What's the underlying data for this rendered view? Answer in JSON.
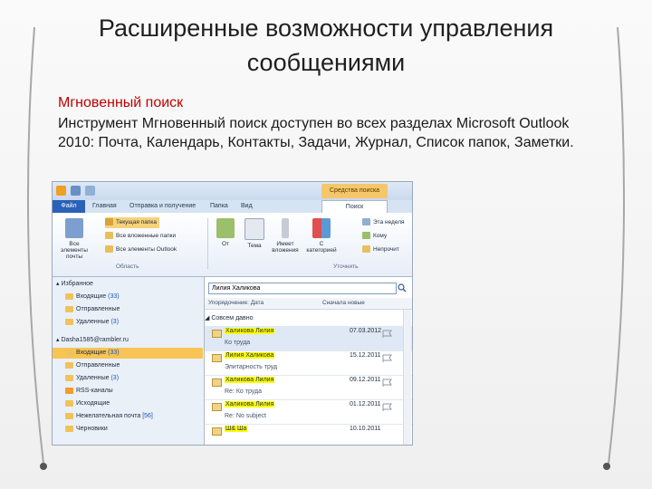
{
  "slide": {
    "title_line1": "Расширенные возможности управления",
    "title_line2": "сообщениями",
    "heading": "Мгновенный поиск",
    "body": "Инструмент Мгновенный поиск доступен во всех разделах Microsoft Outlook 2010: Почта, Календарь,  Контакты, Задачи, Журнал, Список папок, Заметки."
  },
  "outlook": {
    "context_tab": "Средства поиска",
    "tabs": {
      "file": "Файл",
      "home": "Главная",
      "send_receive": "Отправка и получение",
      "folder": "Папка",
      "view": "Вид",
      "search": "Поиск"
    },
    "ribbon": {
      "all_items": "Все элементы почты",
      "current_folder": "Текущая папка",
      "all_subfolders": "Все вложенные папки",
      "all_outlook": "Все элементы Outlook",
      "scope_group": "Область",
      "from": "От",
      "subject": "Тема",
      "has_attachments": "Имеет вложения",
      "categorized": "С категорией",
      "this_week": "Эта неделя",
      "sent_to": "Кому",
      "unread": "Непрочит",
      "refine_group": "Уточнить"
    },
    "nav": {
      "favorites": "Избранное",
      "inbox_fav": "Входящие",
      "inbox_fav_count": "(33)",
      "sent_fav": "Отправленные",
      "deleted_fav": "Удаленные",
      "deleted_fav_count": "(3)",
      "account": "Dasha1585@rambler.ru",
      "inbox": "Входящие",
      "inbox_count": "(33)",
      "sent": "Отправленные",
      "deleted": "Удаленные",
      "deleted_count": "(3)",
      "rss": "RSS-каналы",
      "outbox": "Исходящие",
      "junk": "Нежелательная почта",
      "junk_count": "[56]",
      "drafts": "Черновики"
    },
    "list": {
      "search_value": "Лилия Халикова",
      "sort_by": "Упорядочение: Дата",
      "sort_order": "Сначала новые",
      "group": "Совсем давно",
      "messages": [
        {
          "from": "Халикова Лилия",
          "subject": "Ко труда",
          "date": "07.03.2012"
        },
        {
          "from": "Лилия Халикова",
          "subject": "Элитарность труд",
          "date": "15.12.2011"
        },
        {
          "from": "Халикова Лилия",
          "subject": "Re: Ко труда",
          "date": "09.12.2011"
        },
        {
          "from": "Халикова Лилия",
          "subject": "Re: No subject",
          "date": "01.12.2011"
        },
        {
          "from": "Ш& Ша",
          "subject": "",
          "date": "10.10.2011"
        }
      ]
    },
    "colors": {
      "file_tab": "#2a61b9",
      "context_tab": "#f5c76a",
      "selection": "#f7c455",
      "highlight": "#ffff00"
    }
  }
}
